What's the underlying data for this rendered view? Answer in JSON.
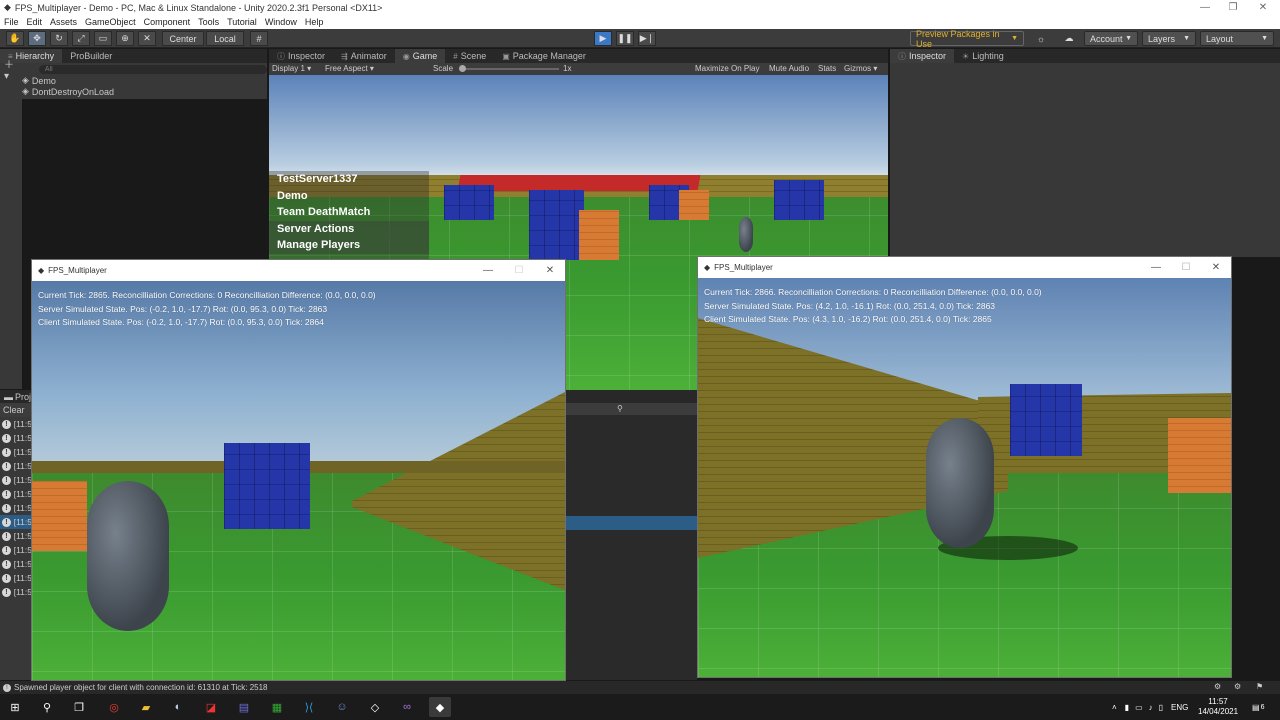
{
  "window_title": "FPS_Multiplayer - Demo - PC, Mac & Linux Standalone - Unity 2020.2.3f1 Personal <DX11>",
  "menu": [
    "File",
    "Edit",
    "Assets",
    "GameObject",
    "Component",
    "Tools",
    "Tutorial",
    "Window",
    "Help"
  ],
  "toolbar": {
    "center_label": "Center",
    "local_label": "Local",
    "preview_packages": "Preview Packages in Use",
    "account": "Account",
    "layers": "Layers",
    "layout": "Layout"
  },
  "hierarchy": {
    "tabs": [
      "Hierarchy",
      "ProBuilder"
    ],
    "search_placeholder": "All",
    "items": [
      "Demo",
      "DontDestroyOnLoad"
    ]
  },
  "center_tabs": [
    "Inspector",
    "Animator",
    "Game",
    "Scene",
    "Package Manager"
  ],
  "game_bar": {
    "display": "Display 1",
    "aspect": "Free Aspect",
    "scale_label": "Scale",
    "scale_value": "1x",
    "maximize": "Maximize On Play",
    "mute": "Mute Audio",
    "stats": "Stats",
    "gizmos": "Gizmos"
  },
  "game_menu": [
    "TestServer1337",
    "Demo",
    "Team DeathMatch",
    "Server Actions",
    "Manage Players"
  ],
  "right_tabs": [
    "Inspector",
    "Lighting"
  ],
  "project": {
    "tab": "Proj",
    "clear": "Clear",
    "rows": [
      "[11:5",
      "[11:5",
      "[11:5",
      "[11:5",
      "[11:5",
      "[11:5",
      "[11:5",
      "[11:5",
      "[11:5",
      "[11:5",
      "[11:5",
      "[11:5",
      "[11:5"
    ]
  },
  "status_bar": "Spawned player object for client with connection id: 61310 at Tick: 2518",
  "client_left": {
    "title": "FPS_Multiplayer",
    "line1": "Current Tick: 2865. Reconcilliation Corrections: 0 Reconcilliation Difference: (0.0, 0.0, 0.0)",
    "line2": "Server Simulated State. Pos: (-0.2, 1.0, -17.7) Rot: (0.0, 95.3, 0.0) Tick: 2863",
    "line3": "Client Simulated State. Pos: (-0.2, 1.0, -17.7) Rot: (0.0, 95.3, 0.0) Tick: 2864"
  },
  "client_right": {
    "title": "FPS_Multiplayer",
    "line1": "Current Tick: 2866. Reconcilliation Corrections: 0 Reconcilliation Difference: (0.0, 0.0, 0.0)",
    "line2": "Server Simulated State. Pos: (4.2, 1.0, -16.1) Rot: (0.0, 251.4, 0.0) Tick: 2863",
    "line3": "Client Simulated State. Pos: (4.3, 1.0, -16.2) Rot: (0.0, 251.4, 0.0) Tick: 2865"
  },
  "tray": {
    "lang": "ENG",
    "time": "11:57",
    "date": "14/04/2021",
    "notif": "6"
  },
  "icons": {
    "play": "play-icon",
    "pause": "pause-icon",
    "step": "step-icon"
  }
}
